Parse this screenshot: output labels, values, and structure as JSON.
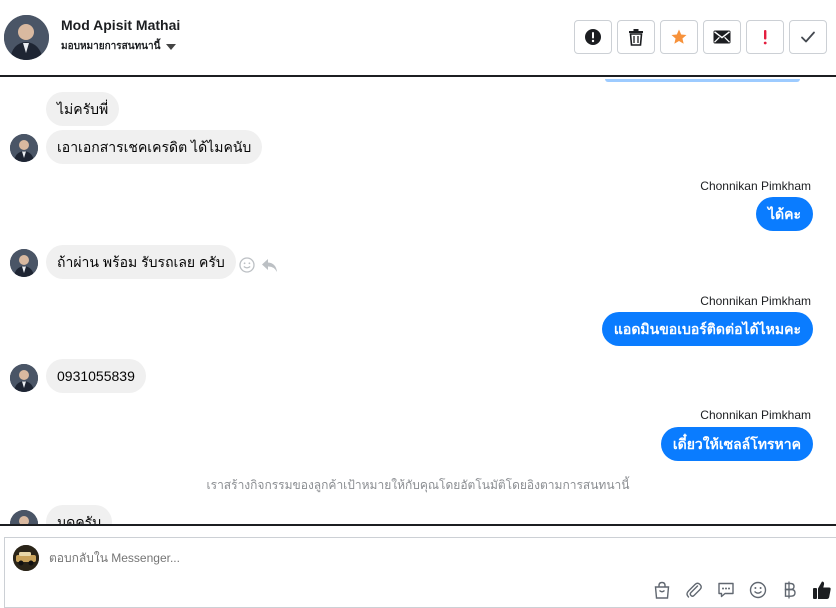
{
  "header": {
    "name": "Mod Apisit Mathai",
    "assign_label": "มอบหมายการสนทนานี้",
    "actions": [
      {
        "icon": "exclamation-circle-icon"
      },
      {
        "icon": "trash-icon"
      },
      {
        "icon": "star-icon"
      },
      {
        "icon": "envelope-icon"
      },
      {
        "icon": "exclamation-icon"
      },
      {
        "icon": "check-icon"
      }
    ],
    "star_color": "#f7923b",
    "alert_color": "#e41e3f"
  },
  "messages": {
    "m1": "ไม่ครับพี่",
    "m2": "เอาเอกสารเชคเครดิต ได้ไมคนับ",
    "sender1": "Chonnikan Pimkham",
    "m3": "ได้คะ",
    "m4": "ถ้าผ่าน พร้อม รับรถเลย ครับ",
    "sender2": "Chonnikan Pimkham",
    "m5": "แอดมินขอเบอร์ติดต่อได้ไหมคะ",
    "m6": "0931055839",
    "sender3": "Chonnikan Pimkham",
    "m7": "เดี๋ยวให้เซลล์โทรหาค",
    "system_note": "เราสร้างกิจกรรมของลูกค้าเป้าหมายให้กับคุณโดยอัตโนมัติโดยอิงตามการสนทนานี้",
    "m8": "มดครับ"
  },
  "composer": {
    "placeholder": "ตอบกลับใน Messenger..."
  },
  "colors": {
    "outgoing_bubble": "#0a7cff",
    "incoming_bubble": "#f0f0f0",
    "thumb": "#1c1e21"
  }
}
